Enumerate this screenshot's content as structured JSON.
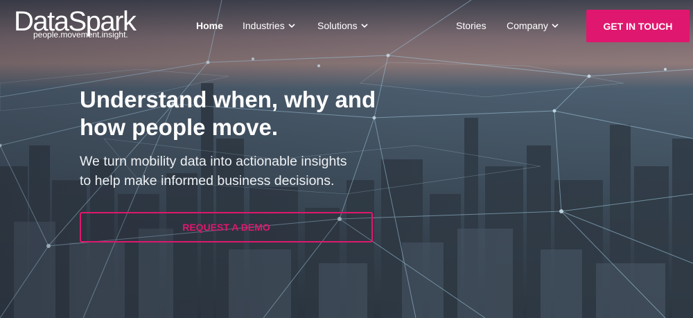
{
  "brand": {
    "logo": "DataSpark",
    "tagline": "people.movement.insight."
  },
  "nav": {
    "items": [
      {
        "label": "Home",
        "active": true,
        "dropdown": false
      },
      {
        "label": "Industries",
        "active": false,
        "dropdown": true
      },
      {
        "label": "Solutions",
        "active": false,
        "dropdown": true
      },
      {
        "label": "Stories",
        "active": false,
        "dropdown": false
      },
      {
        "label": "Company",
        "active": false,
        "dropdown": true
      }
    ],
    "cta_label": "GET IN TOUCH"
  },
  "hero": {
    "headline_line1": "Understand when, why and",
    "headline_line2": "how people move.",
    "sub_line1": "We turn mobility data into actionable insights",
    "sub_line2": "to help make informed business decisions.",
    "demo_label": "REQUEST A DEMO"
  },
  "colors": {
    "accent": "#e0176e",
    "text": "#ffffff"
  },
  "icons": [
    "chevron-down-icon",
    "network-node-icon"
  ]
}
